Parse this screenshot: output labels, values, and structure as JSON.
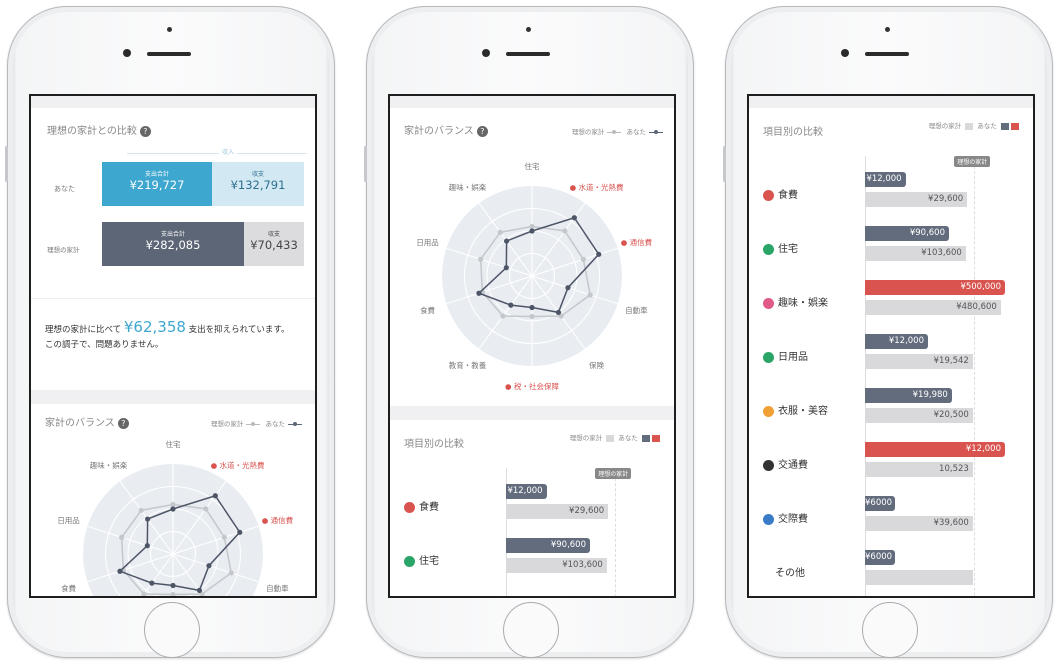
{
  "compare": {
    "title": "理想の家計との比較",
    "income_label": "収入",
    "you_label": "あなた",
    "ideal_label": "理想の家計",
    "you_expense_label": "支出合計",
    "you_expense": "¥219,727",
    "you_balance_label": "収支",
    "you_balance": "¥132,791",
    "ideal_expense_label": "支出合計",
    "ideal_expense": "¥282,085",
    "ideal_balance_label": "収支",
    "ideal_balance": "¥70,433",
    "msg_prefix": "理想の家計に比べて",
    "msg_amount": "¥62,358",
    "msg_suffix": "支出を抑えられています。",
    "msg_line2": "この調子で、問題ありません。"
  },
  "balance": {
    "title": "家計のバランス",
    "legend_ideal": "理想の家計",
    "legend_you": "あなた",
    "axes": [
      "住宅",
      "水道・光熱費",
      "通信費",
      "自動車",
      "保険",
      "税・社会保障",
      "教育・教養",
      "食費",
      "日用品",
      "趣味・娯楽"
    ],
    "ideal_levels": [
      0.55,
      0.62,
      0.6,
      0.68,
      0.55,
      0.45,
      0.55,
      0.58,
      0.6,
      0.6
    ],
    "you_levels": [
      0.5,
      0.8,
      0.78,
      0.42,
      0.5,
      0.35,
      0.4,
      0.62,
      0.3,
      0.48
    ]
  },
  "items": {
    "title": "項目別の比較",
    "legend_ideal": "理想の家計",
    "legend_you": "あなた",
    "ideal_tag": "理想の家計",
    "rows": [
      {
        "name": "食費",
        "you": "¥12,000",
        "ideal": "¥29,600",
        "you_frac": 0.29,
        "ideal_frac": 0.73,
        "color": "#d9534f",
        "red": false
      },
      {
        "name": "住宅",
        "you": "¥90,600",
        "ideal": "¥103,600",
        "you_frac": 0.6,
        "ideal_frac": 0.72,
        "color": "#2aa567",
        "red": false
      },
      {
        "name": "趣味・娯楽",
        "you": "¥500,000",
        "ideal": "¥480,600",
        "you_frac": 1.0,
        "ideal_frac": 0.97,
        "color": "#e05a8a",
        "red": true
      },
      {
        "name": "日用品",
        "you": "¥12,000",
        "ideal": "¥19,542",
        "you_frac": 0.45,
        "ideal_frac": 0.77,
        "color": "#2aa567",
        "red": false
      },
      {
        "name": "衣服・美容",
        "you": "¥19,980",
        "ideal": "¥20,500",
        "you_frac": 0.62,
        "ideal_frac": 0.77,
        "color": "#f0a035",
        "red": false
      },
      {
        "name": "交通費",
        "you": "¥12,000",
        "ideal": "10,523",
        "you_frac": 1.0,
        "ideal_frac": 0.77,
        "color": "#333333",
        "red": true
      },
      {
        "name": "交際費",
        "you": "¥6000",
        "ideal": "¥39,600",
        "you_frac": 0.2,
        "ideal_frac": 0.77,
        "color": "#3a7bc8",
        "red": false
      },
      {
        "name": "その他",
        "you": "¥6000",
        "ideal": "",
        "you_frac": 0.2,
        "ideal_frac": 0.77,
        "color": "",
        "red": false
      }
    ]
  }
}
